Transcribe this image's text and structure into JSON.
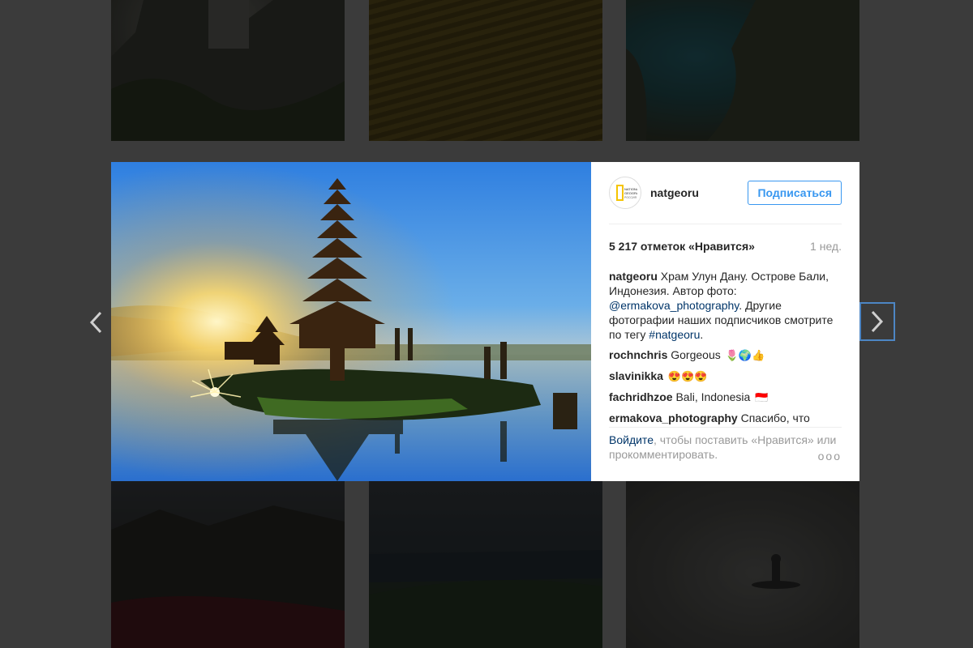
{
  "profile": {
    "username": "natgeoru",
    "avatar_text": "NATIONAL GEOGRAPHIC РОССИЯ",
    "follow_label": "Подписаться"
  },
  "post": {
    "likes": "5 217 отметок «Нравится»",
    "time": "1 нед."
  },
  "caption": {
    "user": "natgeoru",
    "text_1": "Храм Улун Дану. Острове Бали, Индонезия. Автор фото:",
    "mention": "@ermakova_photography",
    "text_2": ". Другие фотографии наших подписчиков смотрите по тегу",
    "hashtag": "#natgeoru",
    "text_3": "."
  },
  "comments": [
    {
      "user": "rochnchris",
      "text": "Gorgeous",
      "emoji": "🌷🌍👍"
    },
    {
      "user": "slavinikka",
      "text": "",
      "emoji": "😍😍😍"
    },
    {
      "user": "fachridhzoe",
      "text": "Bali, Indonesia",
      "emoji": "🇮🇩"
    },
    {
      "user": "ermakova_photography",
      "text": "Спасибо, что",
      "emoji": ""
    }
  ],
  "footer": {
    "login_link": "Войдите",
    "login_text": ", чтобы поставить «Нравится» или прокомментировать.",
    "more_label": "ooo"
  },
  "icons": {
    "prev": "chevron-left-icon",
    "next": "chevron-right-icon"
  },
  "colors": {
    "accent": "#3897f0",
    "link": "#003569",
    "backdrop": "#3b3b3b",
    "selection": "#4d86c4"
  }
}
